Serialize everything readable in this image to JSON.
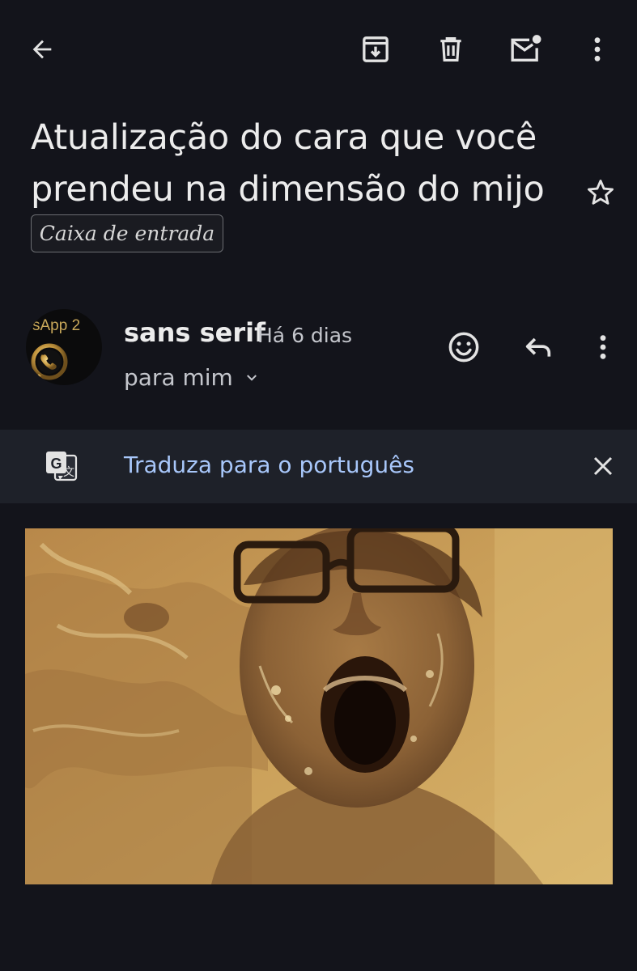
{
  "toolbar": {
    "back_icon": "arrow-left-icon",
    "archive_icon": "archive-icon",
    "delete_icon": "trash-icon",
    "mark_unread_icon": "mail-dot-icon",
    "more_icon": "more-vertical-icon"
  },
  "email": {
    "subject": "Atualização do cara que você prendeu na dimensão do mijo",
    "label": "Caixa de entrada",
    "star_icon": "star-outline-icon"
  },
  "sender": {
    "avatar_text": "sApp 2",
    "avatar_icon": "phone-handset-icon",
    "name": "sans serif",
    "time": "Há 6 dias",
    "recipient": "para mim",
    "recipient_icon": "chevron-down-icon",
    "emoji_icon": "smiley-icon",
    "reply_icon": "reply-icon",
    "more_icon": "more-vertical-icon"
  },
  "translate": {
    "icon": "translate-icon",
    "link_text": "Traduza para o português",
    "close_icon": "close-icon"
  },
  "attachment": {
    "type": "image",
    "subject_description_icon": "gif-image"
  },
  "colors": {
    "background": "#13141b",
    "translate_bar": "#1e2129",
    "link": "#a8c7fa",
    "text": "#ececec",
    "image_tone": "#c79f55"
  }
}
